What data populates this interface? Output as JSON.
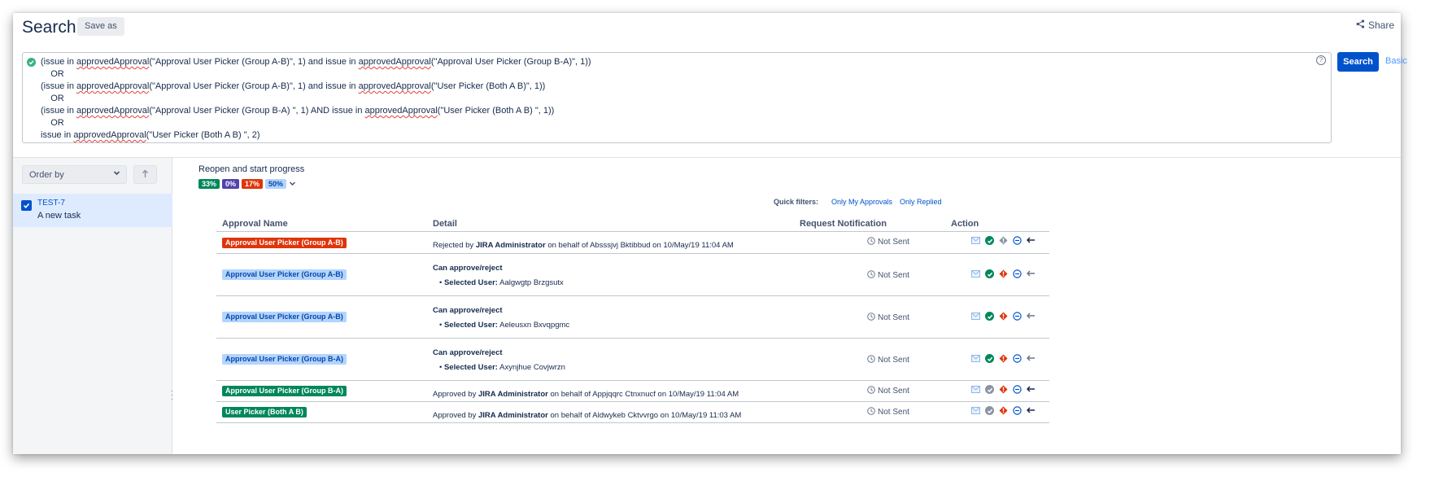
{
  "header": {
    "title": "Search",
    "save_as_label": "Save as",
    "share_label": "Share"
  },
  "jql": {
    "lines": [
      [
        {
          "t": "(issue in "
        },
        {
          "t": "approvedApproval",
          "fn": true
        },
        {
          "t": "(\"Approval User Picker (Group A-B)\", 1) and issue in "
        },
        {
          "t": "approvedApproval",
          "fn": true
        },
        {
          "t": "(\"Approval User Picker (Group B-A)\", 1))"
        }
      ],
      [
        {
          "t": "    OR"
        }
      ],
      [
        {
          "t": "(issue in "
        },
        {
          "t": "approvedApproval",
          "fn": true
        },
        {
          "t": "(\"Approval User Picker (Group A-B)\", 1) and issue in "
        },
        {
          "t": "approvedApproval",
          "fn": true
        },
        {
          "t": "(\"User Picker (Both A B)\", 1))"
        }
      ],
      [
        {
          "t": "    OR"
        }
      ],
      [
        {
          "t": "(issue in "
        },
        {
          "t": "approvedApproval",
          "fn": true
        },
        {
          "t": "(\"Approval User Picker (Group B-A) \", 1) AND issue in "
        },
        {
          "t": "approvedApproval",
          "fn": true
        },
        {
          "t": "(\"User Picker (Both A B) \", 1))"
        }
      ],
      [
        {
          "t": "    OR"
        }
      ],
      [
        {
          "t": "issue in "
        },
        {
          "t": "approvedApproval",
          "fn": true
        },
        {
          "t": "(\"User Picker (Both A B) \", 2)"
        }
      ]
    ],
    "search_label": "Search",
    "basic_label": "Basic"
  },
  "sidebar": {
    "order_by_label": "Order by",
    "issue": {
      "key": "TEST-7",
      "summary": "A new task",
      "checked": true
    }
  },
  "main": {
    "status_title": "Reopen and start progress",
    "badges": [
      {
        "label": "33%",
        "color": "#00875a"
      },
      {
        "label": "0%",
        "color": "#5243aa"
      },
      {
        "label": "17%",
        "color": "#de350b"
      },
      {
        "label": "50%",
        "color": "#4c9aff"
      }
    ],
    "quick_filters_label": "Quick filters:",
    "quick_filters": [
      "Only My Approvals",
      "Only Replied"
    ],
    "columns": [
      "Approval Name",
      "Detail",
      "Request Notification",
      "Action"
    ],
    "rows": [
      {
        "name": "Approval User Picker (Group A-B)",
        "style": "rejected",
        "detail_prefix": "Rejected by ",
        "detail_bold": "JIRA Administrator",
        "detail_suffix": " on behalf of Absssjvj Bktibbud on 10/May/19 11:04 AM",
        "notification": "Not Sent",
        "approve_active": true,
        "reject_active": false,
        "reply_active": true
      },
      {
        "name": "Approval User Picker (Group A-B)",
        "style": "pending",
        "can_label": "Can approve/reject",
        "selected_label": "Selected User:",
        "selected_user": "Aalgwgtp Brzgsutx",
        "notification": "Not Sent",
        "approve_active": true,
        "reject_active": true,
        "reply_active": false
      },
      {
        "name": "Approval User Picker (Group A-B)",
        "style": "pending",
        "can_label": "Can approve/reject",
        "selected_label": "Selected User:",
        "selected_user": "Aeleusxn Bxvqpgmc",
        "notification": "Not Sent",
        "approve_active": true,
        "reject_active": true,
        "reply_active": false
      },
      {
        "name": "Approval User Picker (Group B-A)",
        "style": "pending",
        "can_label": "Can approve/reject",
        "selected_label": "Selected User:",
        "selected_user": "Axynjhue Covjwrzn",
        "notification": "Not Sent",
        "approve_active": true,
        "reject_active": true,
        "reply_active": false
      },
      {
        "name": "Approval User Picker (Group B-A)",
        "style": "approved",
        "detail_prefix": "Approved by ",
        "detail_bold": "JIRA Administrator",
        "detail_suffix": " on behalf of Appjqqrc Ctnxnucf on 10/May/19 11:04 AM",
        "notification": "Not Sent",
        "approve_active": false,
        "reject_active": true,
        "reply_active": true
      },
      {
        "name": "User Picker (Both A B)",
        "style": "approved",
        "detail_prefix": "Approved by ",
        "detail_bold": "JIRA Administrator",
        "detail_suffix": " on behalf of Aldwykeb Cktvvrgo on 10/May/19 11:03 AM",
        "notification": "Not Sent",
        "approve_active": false,
        "reject_active": true,
        "reply_active": true
      }
    ]
  },
  "colors": {
    "primary": "#0052cc",
    "approved": "#00875a",
    "rejected": "#de350b",
    "pending_bg": "#b3d4ff",
    "pending_text": "#0747a6"
  }
}
